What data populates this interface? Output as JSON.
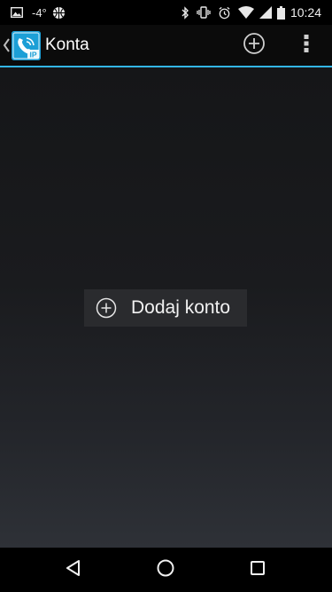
{
  "status_bar": {
    "temperature": "-4°",
    "time": "10:24",
    "icons": [
      "image-notification-icon",
      "basketball-icon",
      "bluetooth-icon",
      "vibrate-icon",
      "alarm-icon",
      "wifi-icon",
      "signal-icon",
      "battery-icon"
    ]
  },
  "action_bar": {
    "title": "Konta",
    "app_icon_label": "IP",
    "accent_color": "#33b5e5",
    "actions": [
      "add-icon",
      "overflow-menu-icon"
    ]
  },
  "main": {
    "add_account_label": "Dodaj konto"
  },
  "nav_bar": {
    "buttons": [
      "back-icon",
      "home-icon",
      "recents-icon"
    ]
  }
}
